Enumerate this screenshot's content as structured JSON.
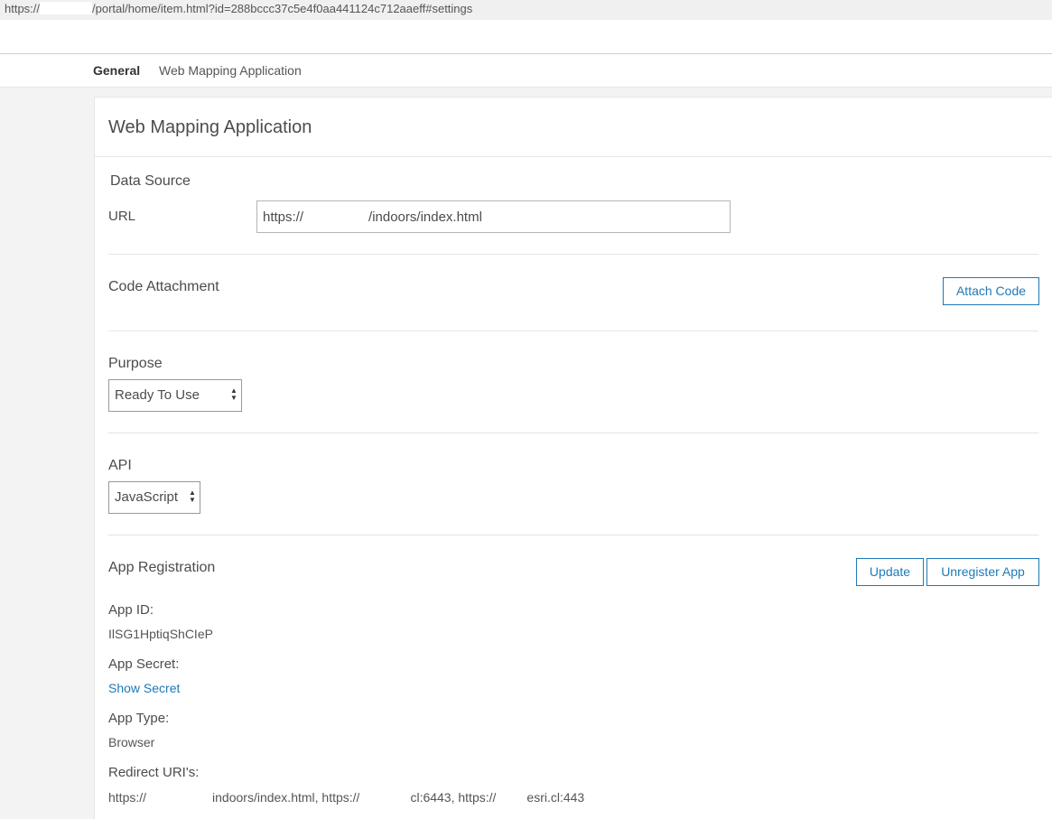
{
  "browser": {
    "url_prefix": "https://",
    "url_suffix": "/portal/home/item.html?id=288bccc37c5e4f0aa441124c712aaeff#settings"
  },
  "tabs": [
    {
      "label": "General"
    },
    {
      "label": "Web Mapping Application"
    }
  ],
  "panel": {
    "title": "Web Mapping Application"
  },
  "data_source": {
    "heading": "Data Source",
    "url_label": "URL",
    "url_prefix": "https://",
    "url_suffix": "/indoors/index.html"
  },
  "code_attachment": {
    "heading": "Code Attachment",
    "button": "Attach Code"
  },
  "purpose": {
    "label": "Purpose",
    "selected": "Ready To Use"
  },
  "api": {
    "label": "API",
    "selected": "JavaScript"
  },
  "app_registration": {
    "heading": "App Registration",
    "update_button": "Update",
    "unregister_button": "Unregister App",
    "app_id_label": "App ID:",
    "app_id_value": "IlSG1HptiqShCIeP",
    "app_secret_label": "App Secret:",
    "show_secret": "Show Secret",
    "app_type_label": "App Type:",
    "app_type_value": "Browser",
    "redirect_label": "Redirect URI's:",
    "redirect_part1": "https://",
    "redirect_part2": "indoors/index.html, https://",
    "redirect_part3": "cl:6443, https://",
    "redirect_part4": "esri.cl:443"
  },
  "colors": {
    "accent": "#1e7ab8",
    "text": "#4c4c4c",
    "background": "#f3f3f3"
  }
}
